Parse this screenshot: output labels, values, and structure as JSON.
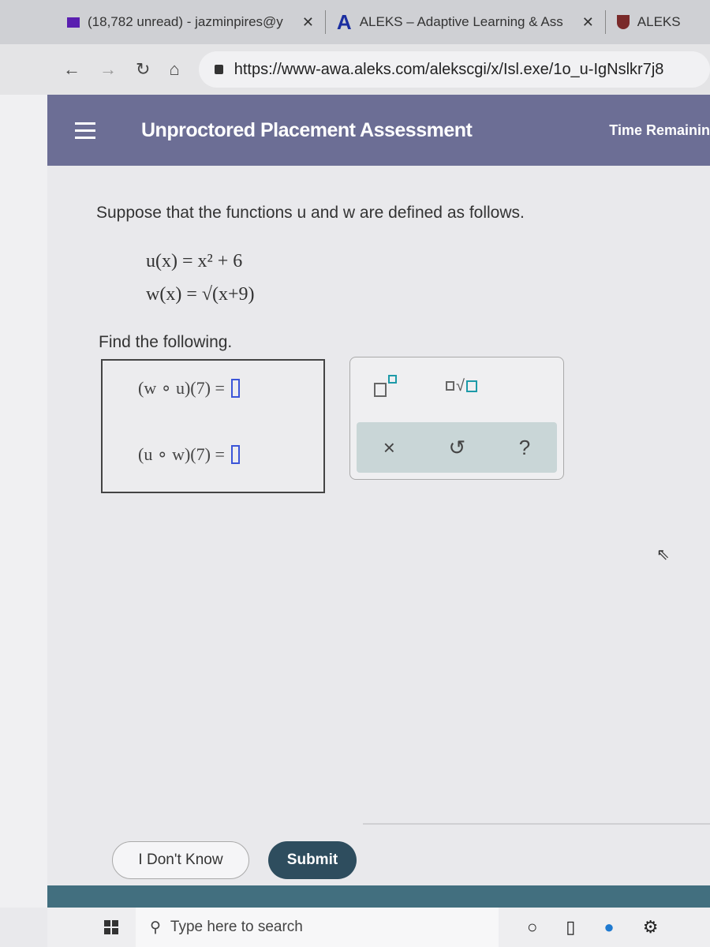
{
  "browser": {
    "tabs": [
      {
        "label": "(18,782 unread) - jazminpires@y",
        "icon": "mail-icon"
      },
      {
        "label": "ALEKS – Adaptive Learning & Ass",
        "icon": "aleks-logo-icon"
      },
      {
        "label": "ALEKS",
        "icon": "shield-icon"
      }
    ],
    "url": "https://www-awa.aleks.com/alekscgi/x/Isl.exe/1o_u-IgNslkr7j8"
  },
  "header": {
    "title": "Unproctored Placement Assessment",
    "time_label": "Time Remainin"
  },
  "question": {
    "prompt": "Suppose that the functions u and w are defined as follows.",
    "u_def": "u(x) = x² + 6",
    "w_def": "w(x) = √(x+9)",
    "find": "Find the following.",
    "parts": [
      {
        "label": "(w ∘ u)(7) =",
        "value": ""
      },
      {
        "label": "(u ∘ w)(7) =",
        "value": ""
      }
    ]
  },
  "keypad": {
    "buttons": [
      "exponent",
      "nth-root",
      "clear",
      "undo",
      "help"
    ],
    "clear": "×",
    "undo": "↺",
    "help": "?"
  },
  "actions": {
    "dont_know": "I Don't Know",
    "submit": "Submit"
  },
  "taskbar": {
    "search_placeholder": "Type here to search"
  }
}
